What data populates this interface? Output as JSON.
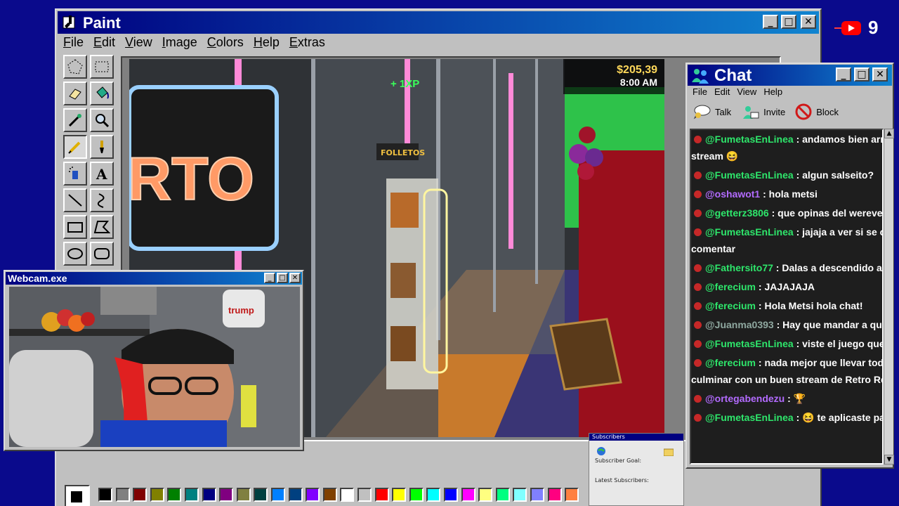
{
  "paint": {
    "title": "Paint",
    "menu": [
      "File",
      "Edit",
      "View",
      "Image",
      "Colors",
      "Help",
      "Extras"
    ],
    "controls": {
      "minimize": "_",
      "maximize": "□",
      "close": "✕"
    },
    "tools": [
      "free-select-icon",
      "rect-select-icon",
      "eraser-icon",
      "fill-icon",
      "eyedropper-icon",
      "magnifier-icon",
      "pencil-icon",
      "brush-icon",
      "airbrush-icon",
      "text-icon",
      "line-icon",
      "curve-icon",
      "rectangle-icon",
      "polygon-icon",
      "ellipse-icon",
      "rounded-rect-icon"
    ],
    "palette": [
      "#000000",
      "#808080",
      "#800000",
      "#808000",
      "#008000",
      "#008080",
      "#000080",
      "#800080",
      "#808040",
      "#004040",
      "#0080ff",
      "#004080",
      "#8000ff",
      "#804000",
      "#ffffff",
      "#c0c0c0",
      "#ff0000",
      "#ffff00",
      "#00ff00",
      "#00ffff",
      "#0000ff",
      "#ff00ff",
      "#ffff80",
      "#00ff80",
      "#80ffff",
      "#8080ff",
      "#ff0080",
      "#ff8040"
    ]
  },
  "game": {
    "money": "$205,39",
    "time": "8:00 AM",
    "xp": "+  1XP",
    "sign_text": "RTO",
    "shelf_label": "FOLLETOS"
  },
  "webcam": {
    "title": "Webcam.exe",
    "mug_text": "trump"
  },
  "chat": {
    "title": "Chat",
    "menu": [
      "File",
      "Edit",
      "View",
      "Help"
    ],
    "toolbar": [
      {
        "label": "Talk",
        "icon": "talk-icon"
      },
      {
        "label": "Invite",
        "icon": "invite-icon"
      },
      {
        "label": "Block",
        "icon": "block-icon"
      }
    ],
    "messages": [
      {
        "user": "@FumetasEnLinea",
        "text": " : andamos bien armando",
        "cont": "stream 😆",
        "color": "#2ee66b"
      },
      {
        "user": "@FumetasEnLinea",
        "text": " : algun salseito?",
        "cont": "",
        "color": "#2ee66b"
      },
      {
        "user": "@oshawot1",
        "text": " : hola metsi",
        "cont": "",
        "color": "#b36bff"
      },
      {
        "user": "@getterz3806",
        "text": " : que opinas del werever",
        "cont": "",
        "color": "#2ee66b"
      },
      {
        "user": "@FumetasEnLinea",
        "text": " : jajaja a ver si se calient",
        "cont": "comentar",
        "color": "#2ee66b"
      },
      {
        "user": "@Fathersito77",
        "text": " : Dalas a descendido a la locu",
        "cont": "",
        "color": "#2ee66b"
      },
      {
        "user": "@ferecium",
        "text": " : JAJAJAJA",
        "cont": "",
        "color": "#2ee66b"
      },
      {
        "user": "@ferecium",
        "text": " : Hola Metsi hola chat!",
        "cont": "",
        "color": "#2ee66b"
      },
      {
        "user": "@Juanma0393",
        "text": " : Hay que mandar a quema",
        "cont": "",
        "color": "#8fa8a0"
      },
      {
        "user": "@FumetasEnLinea",
        "text": " : viste el juego que te pus",
        "cont": "",
        "color": "#2ee66b"
      },
      {
        "user": "@ferecium",
        "text": " : nada mejor que llevar toda la",
        "cont": "culminar con un buen stream de Retro Rewind",
        "color": "#2ee66b"
      },
      {
        "user": "@ortegabendezu",
        "text": " : 🏆",
        "cont": "",
        "color": "#b36bff"
      },
      {
        "user": "@FumetasEnLinea",
        "text": " : 😆  te aplicaste para pe",
        "cont": "",
        "color": "#2ee66b"
      }
    ]
  },
  "subscribers": {
    "title": "Subscribers",
    "goal_label": "Subscriber Goal:",
    "latest_label": "Latest Subscribers:"
  },
  "youtube": {
    "count": "9"
  }
}
